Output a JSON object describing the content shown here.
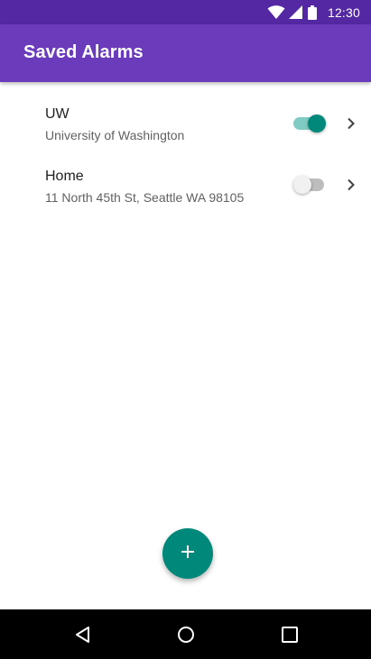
{
  "status_bar": {
    "time": "12:30",
    "icons": [
      "wifi-icon",
      "cell-signal-icon",
      "battery-icon"
    ],
    "background": "#5427a3"
  },
  "app_bar": {
    "title": "Saved Alarms",
    "background": "#6a3cbc"
  },
  "alarms": [
    {
      "name": "UW",
      "address": "University of Washington",
      "enabled": true
    },
    {
      "name": "Home",
      "address": "11 North 45th St, Seattle WA 98105",
      "enabled": false
    }
  ],
  "fab": {
    "icon": "plus-icon",
    "color": "#00897b"
  },
  "nav_bar": {
    "icons": [
      "back-icon",
      "home-icon",
      "recents-icon"
    ]
  },
  "colors": {
    "accent": "#00897b",
    "switch_track_on": "#80cbc4",
    "switch_track_off": "#bdbdbd"
  }
}
